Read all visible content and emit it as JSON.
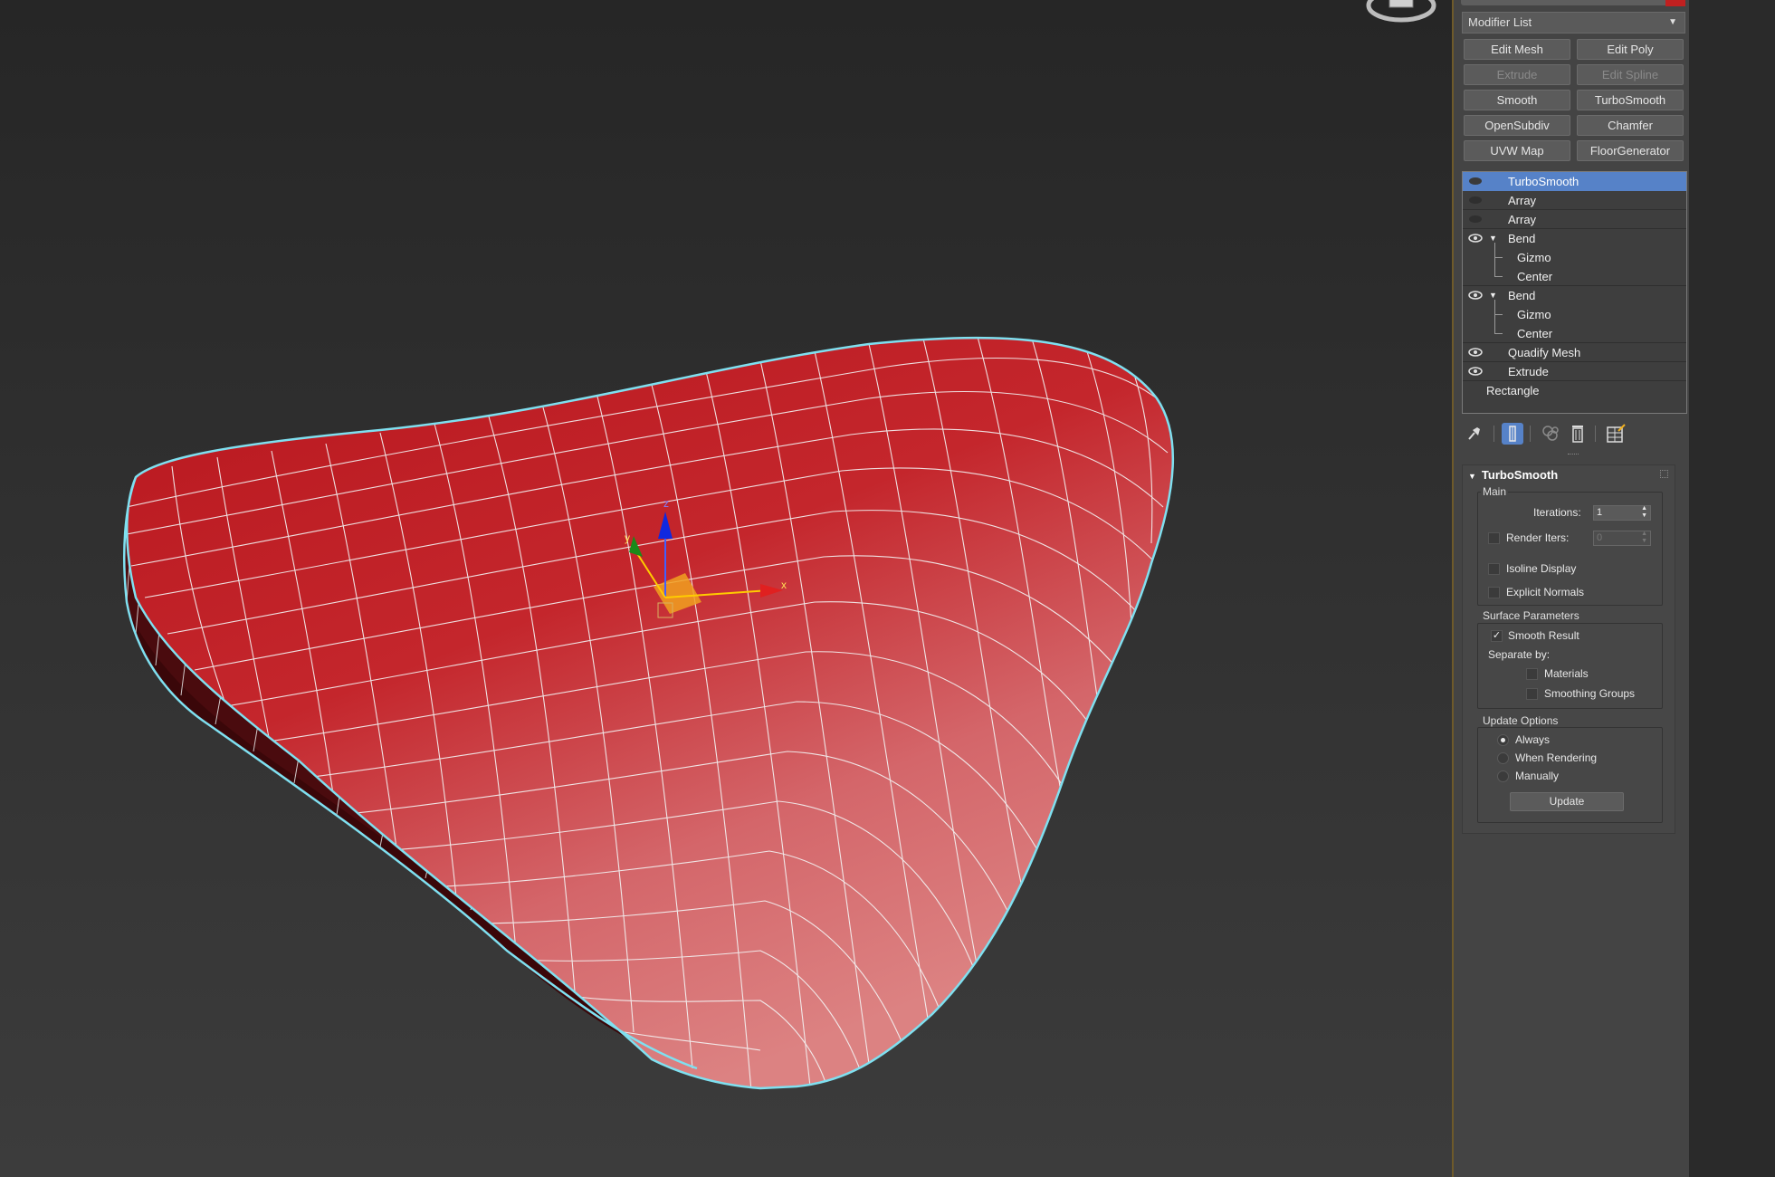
{
  "command_panel": {
    "modifier_list": {
      "label": "Modifier List",
      "arrow": "dropdown-arrow-icon"
    },
    "modifier_buttons": [
      {
        "label": "Edit Mesh",
        "enabled": true
      },
      {
        "label": "Edit Poly",
        "enabled": true
      },
      {
        "label": "Extrude",
        "enabled": false
      },
      {
        "label": "Edit Spline",
        "enabled": false
      },
      {
        "label": "Smooth",
        "enabled": true
      },
      {
        "label": "TurboSmooth",
        "enabled": true
      },
      {
        "label": "OpenSubdiv",
        "enabled": true
      },
      {
        "label": "Chamfer",
        "enabled": true
      },
      {
        "label": "UVW Map",
        "enabled": true
      },
      {
        "label": "FloorGenerator",
        "enabled": true
      }
    ],
    "stack": [
      {
        "label": "TurboSmooth",
        "selected": true,
        "eye": "dim"
      },
      {
        "label": "Array",
        "eye": "dim"
      },
      {
        "label": "Array",
        "eye": "dim"
      },
      {
        "label": "Bend",
        "eye": "on",
        "expanded": true
      },
      {
        "label": "Gizmo",
        "child": true
      },
      {
        "label": "Center",
        "child": true
      },
      {
        "label": "Bend",
        "eye": "on",
        "expanded": true
      },
      {
        "label": "Gizmo",
        "child": true
      },
      {
        "label": "Center",
        "child": true
      },
      {
        "label": "Quadify Mesh",
        "eye": "on"
      },
      {
        "label": "Extrude",
        "eye": "on"
      },
      {
        "label": "Rectangle",
        "base": true
      }
    ],
    "toolbar_icons": [
      "pin-stack-icon",
      "show-end-result-icon",
      "make-unique-icon",
      "remove-modifier-icon",
      "configure-modifier-sets-icon"
    ],
    "rollout": {
      "title": "TurboSmooth",
      "main": {
        "label": "Main",
        "iterations_label": "Iterations:",
        "iterations_value": "1",
        "render_iters_label": "Render Iters:",
        "render_iters_value": "0",
        "render_iters_checked": false,
        "isoline_label": "Isoline Display",
        "isoline_checked": false,
        "explicit_label": "Explicit Normals",
        "explicit_checked": false
      },
      "surface": {
        "label": "Surface Parameters",
        "smooth_label": "Smooth Result",
        "smooth_checked": true,
        "separate_label": "Separate by:",
        "materials_label": "Materials",
        "smoothing_groups_label": "Smoothing Groups"
      },
      "update": {
        "label": "Update Options",
        "options": [
          "Always",
          "When Rendering",
          "Manually"
        ],
        "selected": "Always",
        "button_label": "Update"
      }
    }
  },
  "viewport": {
    "object_color": "#c8232b",
    "selection_outline_color": "#7fe0f0",
    "gizmo_axes": {
      "x": "x",
      "y": "y",
      "z": "z"
    }
  }
}
